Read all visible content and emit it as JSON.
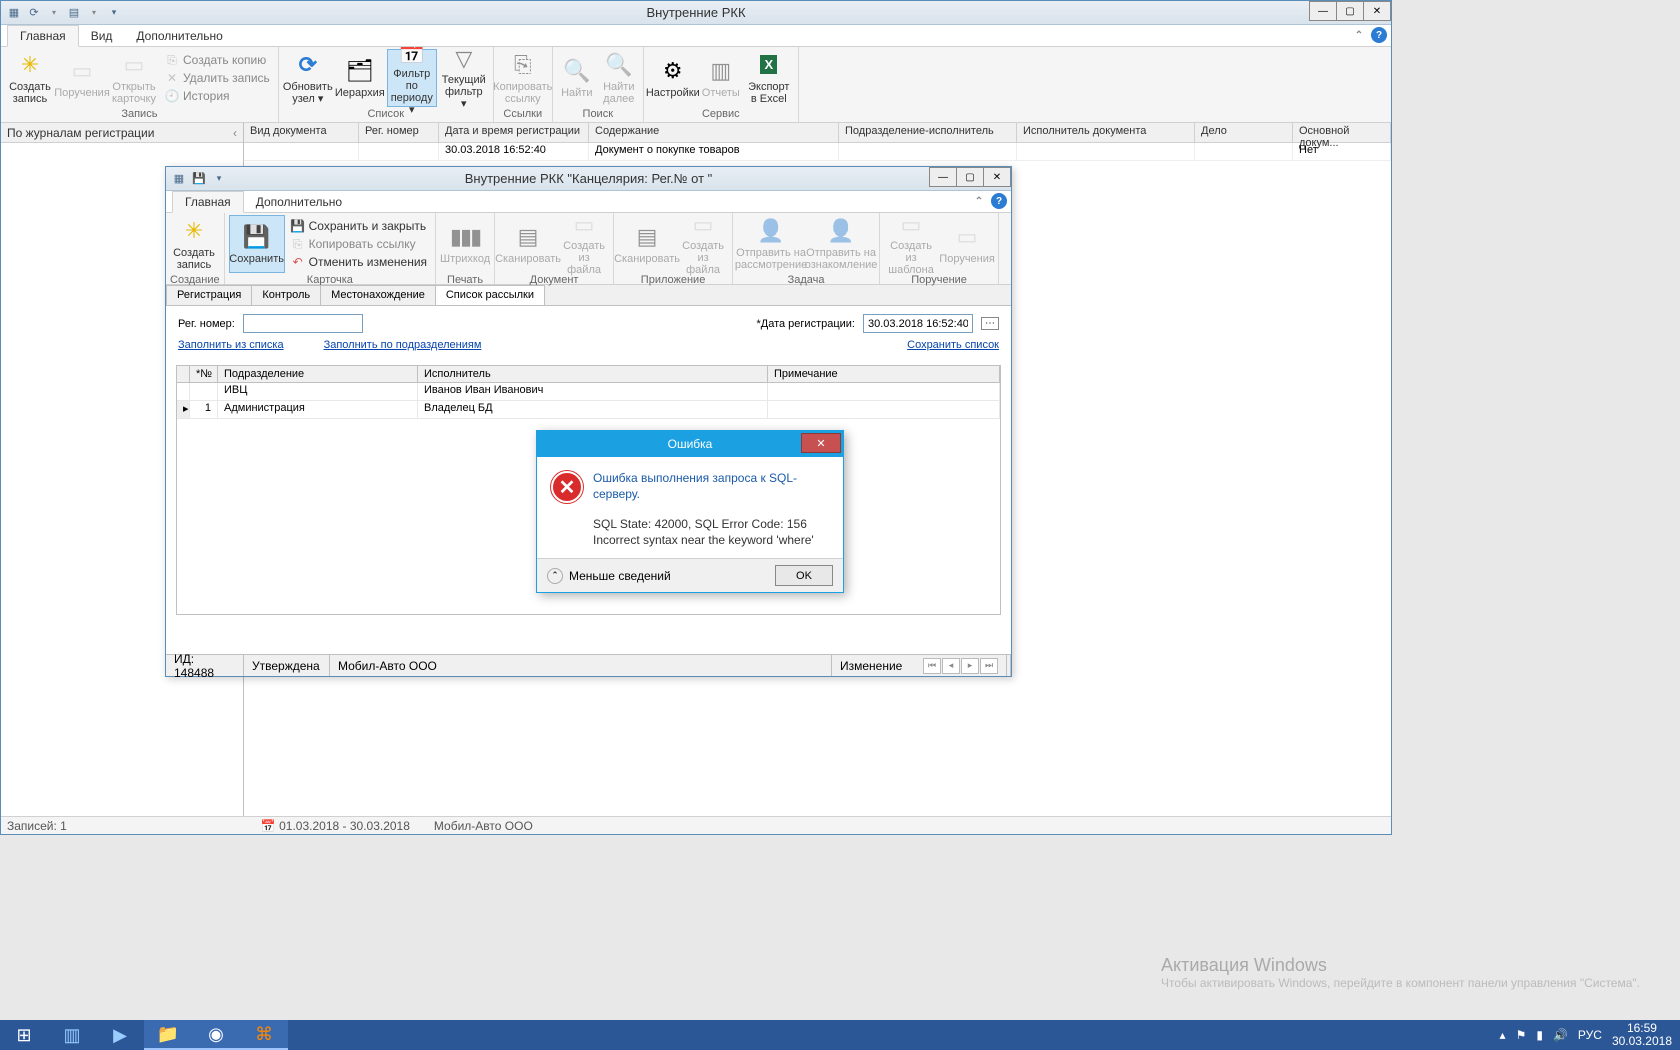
{
  "main": {
    "title": "Внутренние РКК",
    "tabs": [
      "Главная",
      "Вид",
      "Дополнительно"
    ],
    "ribbon": {
      "g1": {
        "label": "Запись",
        "btns": [
          {
            "l": "Создать запись"
          },
          {
            "l": "Поручения"
          },
          {
            "l": "Открыть карточку"
          }
        ],
        "small": [
          "Создать копию",
          "Удалить запись",
          "История"
        ]
      },
      "g2": {
        "label": "Список",
        "btns": [
          {
            "l": "Обновить узел ▾"
          },
          {
            "l": "Иерархия"
          },
          {
            "l": "Фильтр по периоду ▾"
          },
          {
            "l": "Текущий фильтр ▾"
          }
        ]
      },
      "g3": {
        "label": "Ссылки",
        "btns": [
          {
            "l": "Копировать ссылку"
          }
        ]
      },
      "g4": {
        "label": "Поиск",
        "btns": [
          {
            "l": "Найти"
          },
          {
            "l": "Найти далее"
          }
        ]
      },
      "g5": {
        "label": "Сервис",
        "btns": [
          {
            "l": "Настройки"
          },
          {
            "l": "Отчеты"
          },
          {
            "l": "Экспорт в Excel"
          }
        ]
      }
    },
    "leftpane_hdr": "По журналам регистрации",
    "grid_cols": [
      "Вид документа",
      "Рег. номер",
      "Дата и время регистрации",
      "Содержание",
      "Подразделение-исполнитель",
      "Исполнитель документа",
      "Дело",
      "Основной докум..."
    ],
    "grid_row": {
      "date": "30.03.2018 16:52:40",
      "content": "Документ о покупке товаров",
      "main": "Нет"
    },
    "status": {
      "records": "Записей: 1",
      "period": "01.03.2018 - 30.03.2018",
      "org": "Мобил-Авто ООО"
    }
  },
  "child": {
    "title": "Внутренние РКК \"Канцелярия: Рег.№  от \"",
    "tabs": [
      "Главная",
      "Дополнительно"
    ],
    "ribbon": {
      "g1": {
        "label": "Создание",
        "btn": "Создать запись"
      },
      "g2": {
        "label": "Карточка",
        "btn": "Сохранить",
        "small": [
          "Сохранить и закрыть",
          "Копировать ссылку",
          "Отменить изменения"
        ]
      },
      "g3": {
        "label": "Печать",
        "btn": "Штрихкод"
      },
      "g4": {
        "label": "Документ",
        "btns": [
          "Сканировать",
          "Создать из файла"
        ]
      },
      "g5": {
        "label": "Приложение",
        "btns": [
          "Сканировать",
          "Создать из файла"
        ]
      },
      "g6": {
        "label": "Задача",
        "btns": [
          "Отправить на рассмотрение",
          "Отправить на ознакомление"
        ]
      },
      "g7": {
        "label": "Поручение",
        "btns": [
          "Создать из шаблона",
          "Поручения"
        ]
      }
    },
    "form_tabs": [
      "Регистрация",
      "Контроль",
      "Местонахождение",
      "Список рассылки"
    ],
    "form": {
      "reg_label": "Рег. номер:",
      "date_label": "*Дата регистрации:",
      "date_value": "30.03.2018 16:52:40",
      "link1": "Заполнить из списка",
      "link2": "Заполнить по подразделениям",
      "link3": "Сохранить список"
    },
    "grid": {
      "cols": [
        "*№",
        "Подразделение",
        "Исполнитель",
        "Примечание"
      ],
      "rows": [
        {
          "n": "",
          "dept": "ИВЦ",
          "exec": "Иванов Иван Иванович",
          "note": ""
        },
        {
          "n": "1",
          "dept": "Администрация",
          "exec": "Владелец БД",
          "note": ""
        }
      ]
    },
    "status": {
      "id": "ИД: 148488",
      "approved": "Утверждена",
      "org": "Мобил-Авто ООО",
      "change": "Изменение"
    }
  },
  "error": {
    "title": "Ошибка",
    "msg": "Ошибка выполнения запроса к SQL-серверу.",
    "detail1": "SQL State: 42000, SQL Error Code: 156",
    "detail2": "Incorrect syntax near the keyword 'where'",
    "less": "Меньше сведений",
    "ok": "OK"
  },
  "watermark": {
    "t1": "Активация Windows",
    "t2": "Чтобы активировать Windows, перейдите в компонент панели управления \"Система\"."
  },
  "tray": {
    "lang": "РУС",
    "time": "16:59",
    "date": "30.03.2018"
  }
}
